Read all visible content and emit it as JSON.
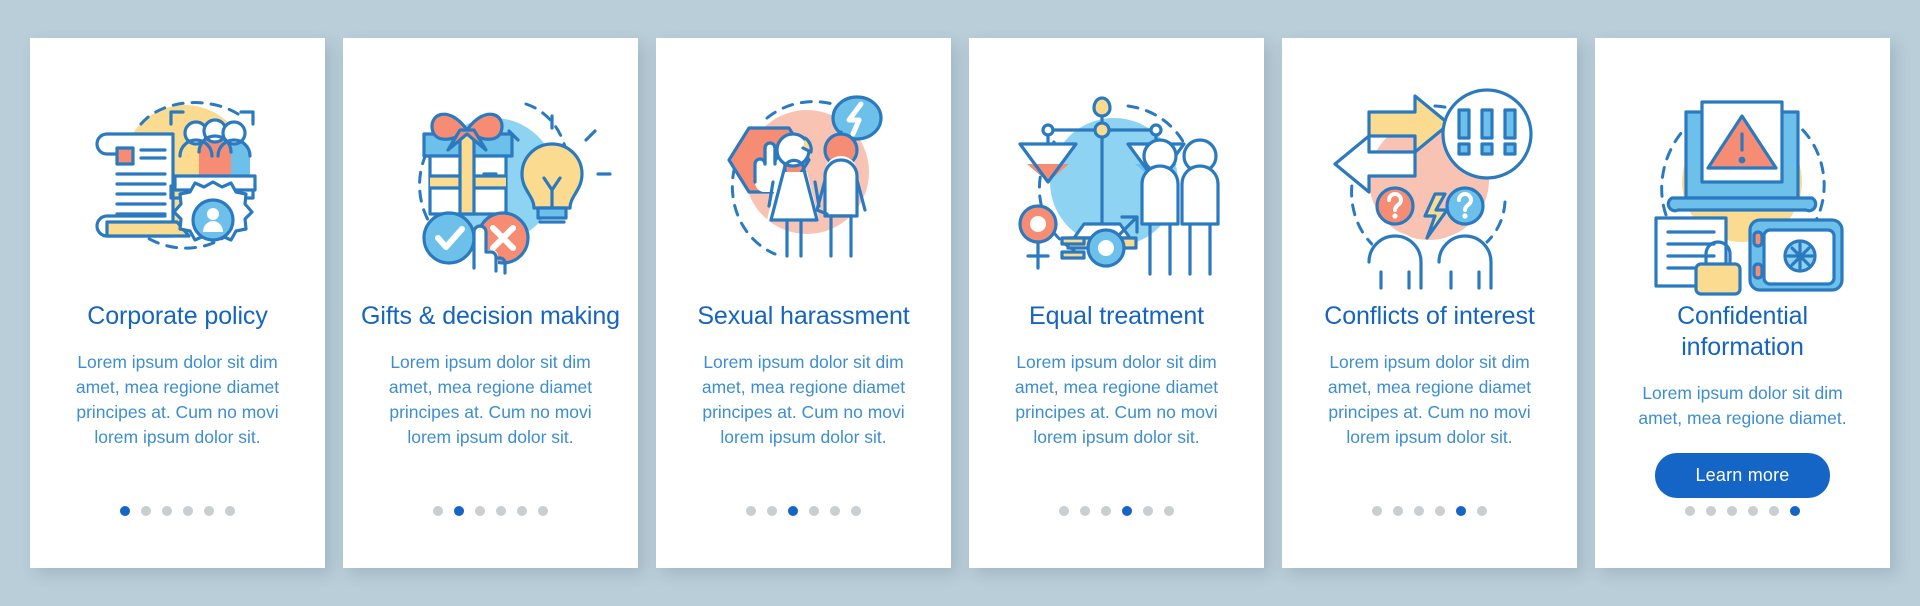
{
  "theme": {
    "page_background": "#b9ced9",
    "card_background": "#ffffff",
    "title_color": "#1565c0",
    "body_color": "#3d8ed0",
    "accent": "#1565c7",
    "dot_inactive": "#c9ced2"
  },
  "common": {
    "body_text": "Lorem ipsum dolor sit dim amet, mea regione diamet principes at. Cum no movi lorem ipsum dolor sit.",
    "dot_count": 6
  },
  "cards": [
    {
      "title": "Corporate policy",
      "body": "Lorem ipsum dolor sit dim amet, mea regione diamet principes at. Cum no movi lorem ipsum dolor sit.",
      "icon": "corporate-policy-illustration",
      "active_dot": 1,
      "button": null
    },
    {
      "title": "Gifts & decision making",
      "body": "Lorem ipsum dolor sit dim amet, mea regione diamet principes at. Cum no movi lorem ipsum dolor sit.",
      "icon": "gifts-decision-making-illustration",
      "active_dot": 2,
      "button": null
    },
    {
      "title": "Sexual harassment",
      "body": "Lorem ipsum dolor sit dim amet, mea regione diamet principes at. Cum no movi lorem ipsum dolor sit.",
      "icon": "sexual-harassment-illustration",
      "active_dot": 3,
      "button": null
    },
    {
      "title": "Equal treatment",
      "body": "Lorem ipsum dolor sit dim amet, mea regione diamet principes at. Cum no movi lorem ipsum dolor sit.",
      "icon": "equal-treatment-illustration",
      "active_dot": 4,
      "button": null
    },
    {
      "title": "Conflicts of interest",
      "body": "Lorem ipsum dolor sit dim amet, mea regione diamet principes at. Cum no movi lorem ipsum dolor sit.",
      "icon": "conflicts-of-interest-illustration",
      "active_dot": 5,
      "button": null
    },
    {
      "title": "Confidential information",
      "body": "Lorem ipsum dolor sit dim amet, mea regione diamet.",
      "icon": "confidential-information-illustration",
      "active_dot": 6,
      "button": "Learn more"
    }
  ]
}
